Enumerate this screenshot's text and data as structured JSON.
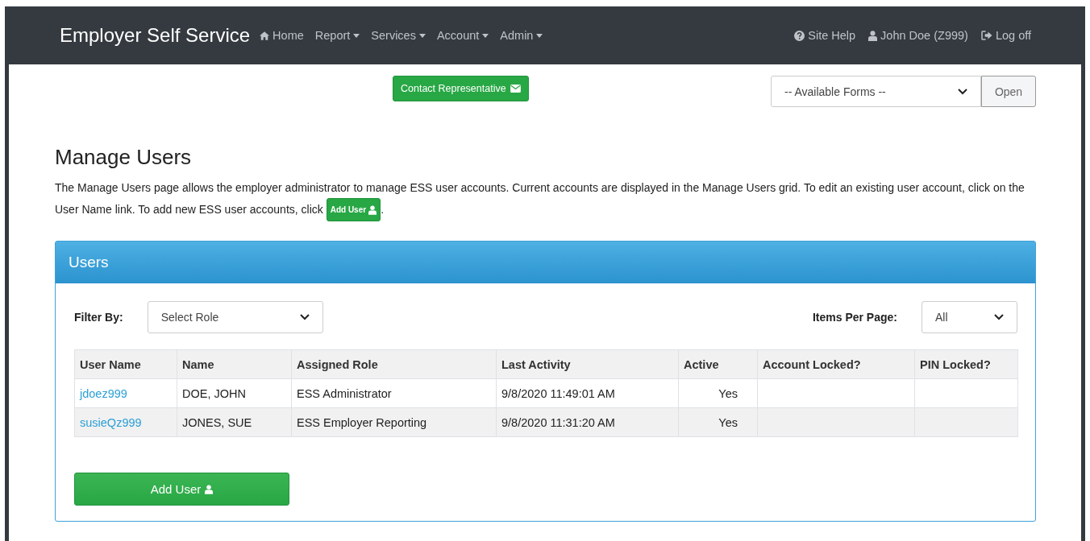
{
  "navbar": {
    "brand": "Employer Self Service",
    "items": [
      {
        "label": "Home",
        "kind": "home"
      },
      {
        "label": "Report",
        "kind": "menu"
      },
      {
        "label": "Services",
        "kind": "menu"
      },
      {
        "label": "Account",
        "kind": "menu"
      },
      {
        "label": "Admin",
        "kind": "menu"
      }
    ],
    "right_items": [
      {
        "label": "Site Help",
        "kind": "help"
      },
      {
        "label": "John Doe (Z999)",
        "kind": "user"
      },
      {
        "label": "Log off",
        "kind": "logout"
      }
    ]
  },
  "contact_button": "Contact Representative",
  "forms_select": {
    "value": "-- Available Forms --"
  },
  "open_button": "Open",
  "heading": "Manage Users",
  "description": {
    "before": "The Manage Users page allows the employer administrator to manage ESS user accounts. Current accounts are displayed in the Manage Users grid. To edit an existing user account, click on the User Name link. To add new ESS user accounts, click ",
    "button": "Add User",
    "after": "."
  },
  "panel": {
    "title": "Users",
    "filter_label": "Filter By:",
    "filter_select": {
      "value": "Select Role"
    },
    "items_label": "Items Per Page:",
    "items_select": {
      "value": "All"
    },
    "table": {
      "columns": [
        "User Name",
        "Name",
        "Assigned Role",
        "Last Activity",
        "Active",
        "Account Locked?",
        "PIN Locked?"
      ],
      "rows": [
        [
          "jdoez999",
          "DOE, JOHN",
          "ESS Administrator",
          "9/8/2020 11:49:01 AM",
          "Yes",
          "",
          ""
        ],
        [
          "susieQz999",
          "JONES, SUE",
          "ESS Employer Reporting",
          "9/8/2020 11:31:20 AM",
          "Yes",
          "",
          ""
        ]
      ]
    },
    "add_button": "Add User"
  }
}
